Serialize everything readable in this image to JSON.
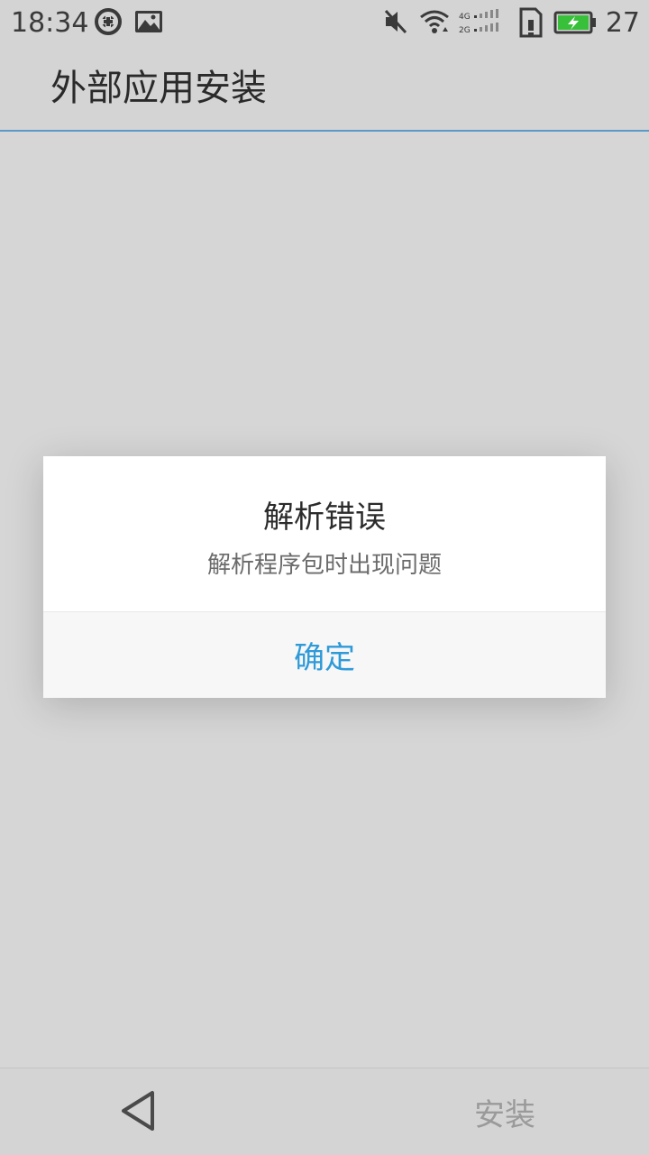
{
  "status_bar": {
    "time": "18:34",
    "battery_level": "27",
    "icons": [
      "sync-icon",
      "image-icon",
      "mute-icon",
      "wifi-icon",
      "cellular-signal-icon",
      "sim-card-icon",
      "battery-charging-icon"
    ],
    "network_labels": [
      "4G",
      "2G"
    ]
  },
  "header": {
    "title": "外部应用安装"
  },
  "dialog": {
    "title": "解析错误",
    "message": "解析程序包时出现问题",
    "confirm_label": "确定"
  },
  "bottom_bar": {
    "install_label": "安装",
    "back_icon": "back-triangle-icon"
  },
  "colors": {
    "accent": "#2f9ad8",
    "header_divider": "#5b9ac7",
    "battery": "#39c03a"
  }
}
